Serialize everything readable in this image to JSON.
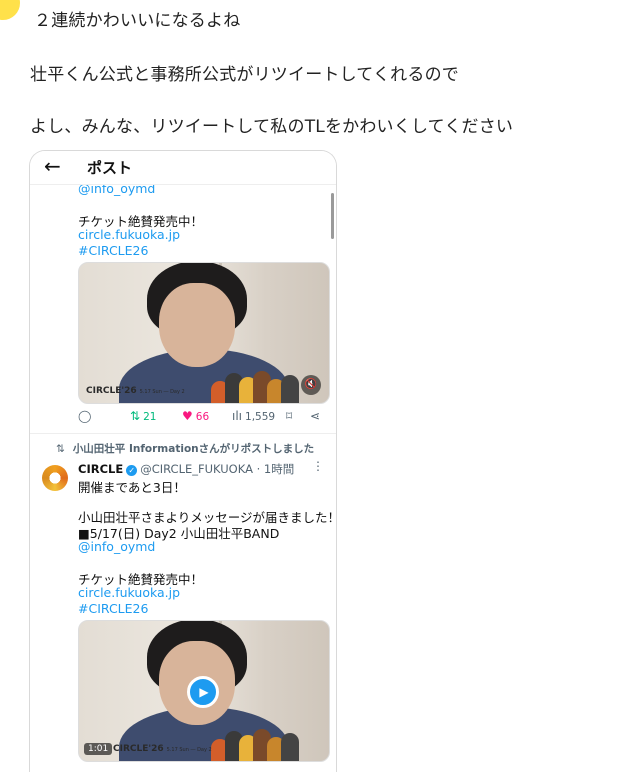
{
  "blog": {
    "line1": "２連続かわいいになるよね",
    "line2": "壮平くん公式と事務所公式がリツイートしてくれるので",
    "line3": "よし、みんな、リツイートして私のTLをかわいくしてください"
  },
  "post_screen": {
    "back_icon": "←",
    "title": "ポスト"
  },
  "tweet1": {
    "handle_partial": "@info_oymd",
    "ticket": "チケット絶賛発売中！",
    "link": "circle.fukuoka.jp",
    "hashtag": "#CIRCLE26",
    "video_brand": "CIRCLE'26",
    "video_sub": "5.17 Sun ― Day 2",
    "mute_icon": "🔇"
  },
  "actions": {
    "reply_icon": "◯",
    "retweet_icon": "⇅",
    "retweets": "21",
    "like_icon": "♥",
    "likes": "66",
    "views_icon": "ılı",
    "views": "1,559",
    "bookmark_icon": "⌑",
    "share_icon": "⋖"
  },
  "tweet2": {
    "repost_icon": "⇅",
    "repost_text": "小山田壮平 Informationさんがリポストしました",
    "author": "CIRCLE",
    "verified_icon": "✓",
    "handle_time": "@CIRCLE_FUKUOKA · 1時間",
    "more_icon": "⋮",
    "line1": "開催まであと3日！",
    "line2": "小山田壮平さまよりメッセージが届きました！",
    "line3": "■5/17(日) Day2 小山田壮平BAND",
    "handle": "@info_oymd",
    "ticket": "チケット絶賛発売中！",
    "link": "circle.fukuoka.jp",
    "hashtag": "#CIRCLE26",
    "video_brand": "CIRCLE'26",
    "video_sub": "5.17 Sun ― Day 2",
    "play_icon": "▶",
    "duration": "1:01"
  },
  "colors": {
    "link": "#1d9bf0",
    "retweet": "#00ba7c",
    "like": "#f91880"
  }
}
